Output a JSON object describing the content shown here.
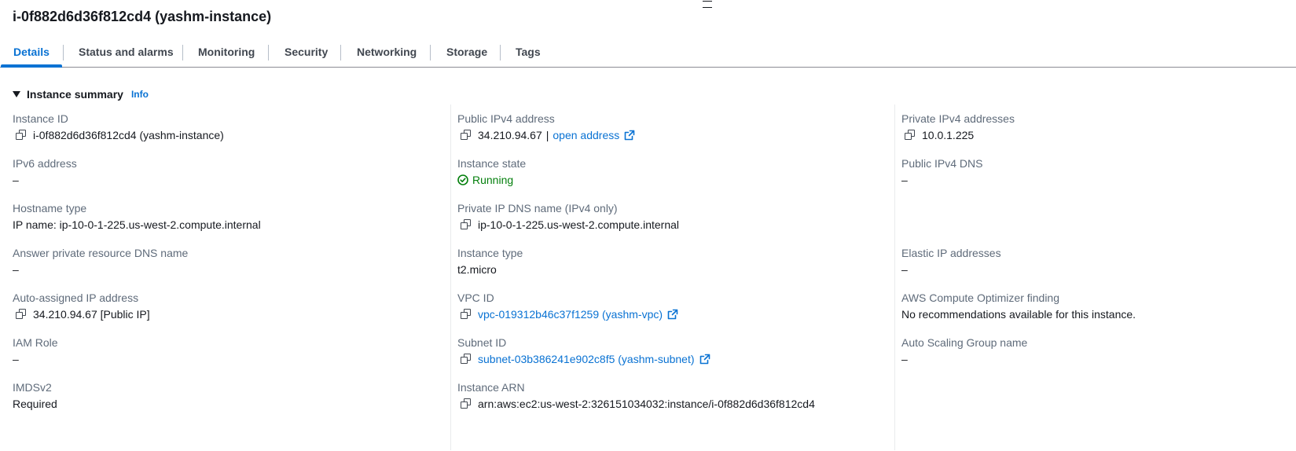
{
  "header": {
    "title": "i-0f882d6d36f812cd4 (yashm-instance)"
  },
  "tabs": [
    {
      "label": "Details",
      "active": true
    },
    {
      "label": "Status and alarms",
      "active": false
    },
    {
      "label": "Monitoring",
      "active": false
    },
    {
      "label": "Security",
      "active": false
    },
    {
      "label": "Networking",
      "active": false
    },
    {
      "label": "Storage",
      "active": false
    },
    {
      "label": "Tags",
      "active": false
    }
  ],
  "summary": {
    "title": "Instance summary",
    "info": "Info"
  },
  "fields": {
    "instance_id": {
      "label": "Instance ID",
      "value": "i-0f882d6d36f812cd4 (yashm-instance)"
    },
    "public_ipv4": {
      "label": "Public IPv4 address",
      "value": "34.210.94.67",
      "separator": "|",
      "link": "open address"
    },
    "private_ipv4": {
      "label": "Private IPv4 addresses",
      "value": "10.0.1.225"
    },
    "ipv6": {
      "label": "IPv6 address",
      "value": "–"
    },
    "instance_state": {
      "label": "Instance state",
      "value": "Running"
    },
    "public_dns": {
      "label": "Public IPv4 DNS",
      "value": "–"
    },
    "hostname_type": {
      "label": "Hostname type",
      "value": "IP name: ip-10-0-1-225.us-west-2.compute.internal"
    },
    "private_dns": {
      "label": "Private IP DNS name (IPv4 only)",
      "value": "ip-10-0-1-225.us-west-2.compute.internal"
    },
    "answer_dns": {
      "label": "Answer private resource DNS name",
      "value": "–"
    },
    "instance_type": {
      "label": "Instance type",
      "value": "t2.micro"
    },
    "elastic_ip": {
      "label": "Elastic IP addresses",
      "value": "–"
    },
    "auto_ip": {
      "label": "Auto-assigned IP address",
      "value": "34.210.94.67 [Public IP]"
    },
    "vpc_id": {
      "label": "VPC ID",
      "value": "vpc-019312b46c37f1259 (yashm-vpc)"
    },
    "optimizer": {
      "label": "AWS Compute Optimizer finding",
      "value": "No recommendations available for this instance."
    },
    "iam_role": {
      "label": "IAM Role",
      "value": "–"
    },
    "subnet_id": {
      "label": "Subnet ID",
      "value": "subnet-03b386241e902c8f5 (yashm-subnet)"
    },
    "asg_name": {
      "label": "Auto Scaling Group name",
      "value": "–"
    },
    "imdsv2": {
      "label": "IMDSv2",
      "value": "Required"
    },
    "instance_arn": {
      "label": "Instance ARN",
      "value": "arn:aws:ec2:us-west-2:326151034032:instance/i-0f882d6d36f812cd4"
    }
  },
  "colors": {
    "link": "#0972d3",
    "running": "#037f0c",
    "label": "#5f6b7a",
    "text": "#16191f"
  }
}
